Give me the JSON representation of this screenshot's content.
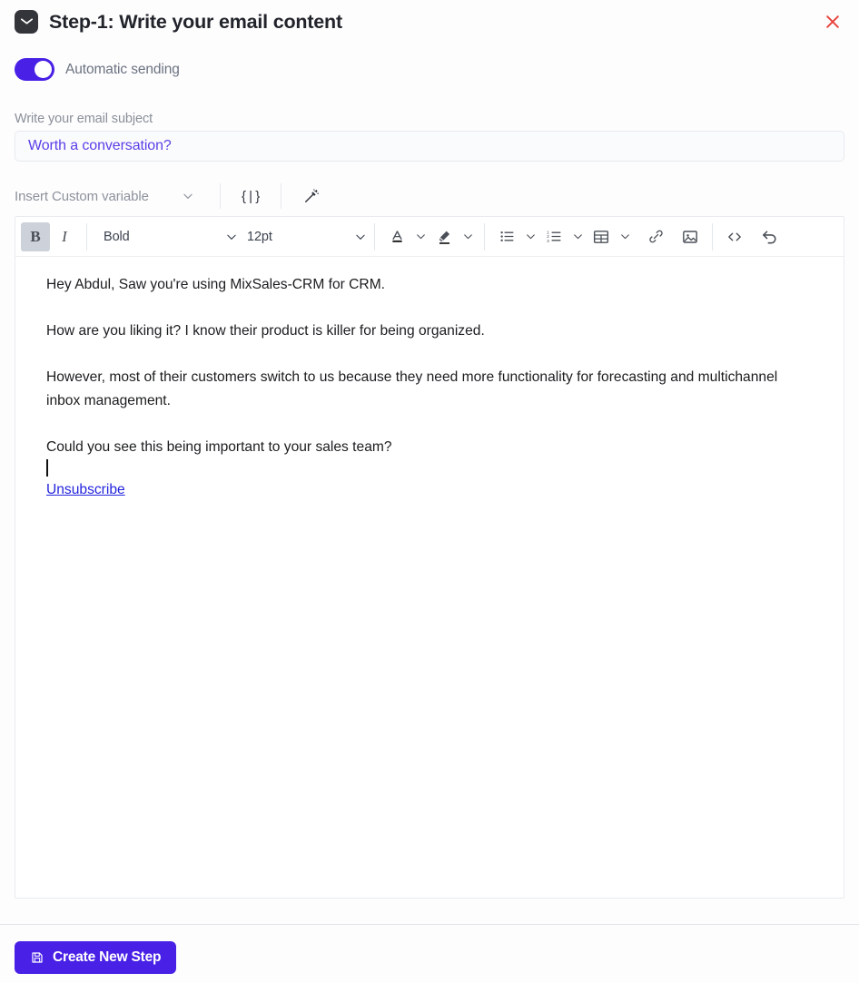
{
  "header": {
    "icon": "envelope-icon",
    "title": "Step-1:  Write your email content",
    "close_icon": "close-icon",
    "close_color": "#e8413a"
  },
  "automatic_sending": {
    "label": "Automatic sending",
    "enabled": true,
    "accent": "#4820e6"
  },
  "subject": {
    "label": "Write your email subject",
    "value": "Worth a conversation?",
    "placeholder": "Write your email subject",
    "text_color": "#5b3fe8"
  },
  "variable_bar": {
    "insert_variable_label": "Insert Custom variable",
    "chevron_icon": "chevron-down-icon",
    "brace_icon": "{ | }",
    "magic_icon": "magic-wand-icon"
  },
  "toolbar": {
    "bold_label": "B",
    "bold_active": true,
    "italic_label": "I",
    "font_family": "Bold",
    "font_size": "12pt",
    "items": [
      "bold-button",
      "italic-button",
      "font-family-select",
      "font-size-select",
      "text-color-button",
      "highlight-color-button",
      "bullet-list-button",
      "numbered-list-button",
      "table-button",
      "link-button",
      "image-button",
      "code-button",
      "undo-button"
    ]
  },
  "email_body": {
    "paragraphs": [
      "Hey Abdul, Saw you're using MixSales-CRM for CRM.",
      "How are you liking it? I know their product is killer for being organized.",
      "However, most of their customers switch to us because they need more functionality for forecasting and multichannel inbox management.",
      "Could you see this being important to your sales team?"
    ],
    "unsubscribe_label": "Unsubscribe",
    "unsubscribe_color": "#2424dd",
    "caret_visible": true
  },
  "footer": {
    "create_step_label": "Create New Step",
    "create_step_icon": "save-icon",
    "button_color": "#4820e6"
  }
}
